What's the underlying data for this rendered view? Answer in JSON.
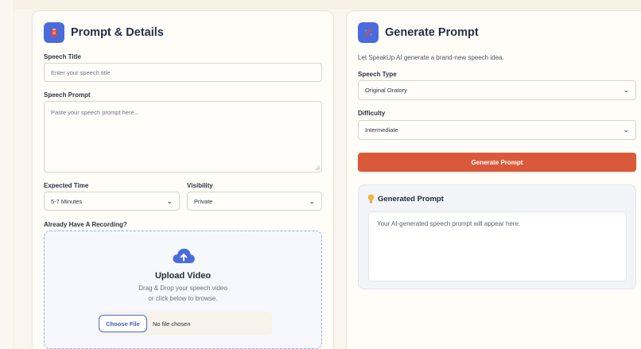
{
  "details_card": {
    "title": "Prompt & Details",
    "icon": "clipboard-icon",
    "speech_title": {
      "label": "Speech Title",
      "placeholder": "Enter your speech title"
    },
    "speech_prompt": {
      "label": "Speech Prompt",
      "placeholder": "Paste your speech prompt here..."
    },
    "expected_time": {
      "label": "Expected Time",
      "value": "5-7 Minutes"
    },
    "visibility": {
      "label": "Visibility",
      "value": "Private"
    },
    "recording": {
      "label": "Already Have A Recording?",
      "upload_title": "Upload Video",
      "upload_line1": "Drag & Drop your speech video",
      "upload_line2": "or click below to browse.",
      "choose_file": "Choose File",
      "file_status": "No file chosen",
      "icon": "cloud-upload-icon"
    }
  },
  "generate_card": {
    "title": "Generate Prompt",
    "icon": "magic-wand-icon",
    "description": "Let SpeakUp AI generate a brand-new speech idea.",
    "speech_type": {
      "label": "Speech Type",
      "value": "Original Oratory"
    },
    "difficulty": {
      "label": "Difficulty",
      "value": "Intermediate"
    },
    "button": "Generate Prompt",
    "result": {
      "title": "Generated Prompt",
      "icon": "lightbulb-icon",
      "placeholder": "Your AI-generated speech prompt will appear here."
    }
  },
  "colors": {
    "accent_blue": "#4a6bdc",
    "accent_orange": "#d9593a",
    "page_bg": "#faf6ef"
  }
}
